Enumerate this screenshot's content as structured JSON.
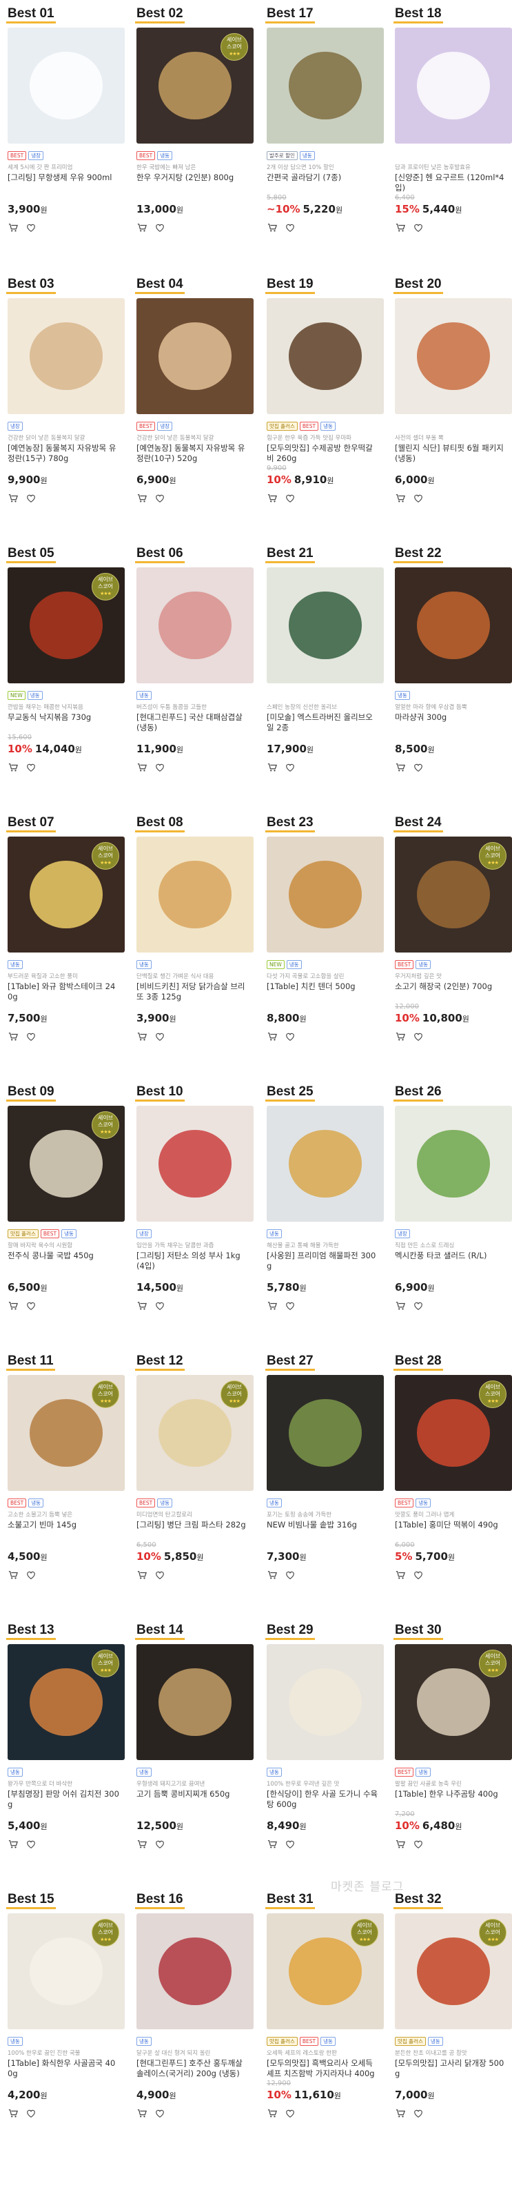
{
  "watermark": "마켓존 블로그",
  "seal_text": {
    "line1": "세이브",
    "line2": "스코어",
    "stars": "★★★"
  },
  "products": [
    {
      "rank": "Best 01",
      "badges": [
        {
          "t": "BEST",
          "k": "best"
        },
        {
          "t": "냉장",
          "k": "cold"
        }
      ],
      "desc": "세계 5시에 갓 짠 프리미엄",
      "name": "[그리팅] 무항생제 우유 900ml",
      "orig": "",
      "rate": "",
      "price": "3,900",
      "color": "#e9eef3",
      "accent": "#ffffff",
      "seal": false
    },
    {
      "rank": "Best 02",
      "badges": [
        {
          "t": "BEST",
          "k": "best"
        },
        {
          "t": "냉동",
          "k": "cold"
        }
      ],
      "desc": "한우 국밥에는 빠져 남은",
      "name": "한우 우거지탕 (2인분) 800g",
      "orig": "",
      "rate": "",
      "price": "13,000",
      "color": "#3a2f2a",
      "accent": "#c7a061",
      "seal": true
    },
    {
      "rank": "Best 17",
      "badges": [
        {
          "t": "발주로 할인",
          "k": "pay"
        },
        {
          "t": "냉동",
          "k": "cold"
        }
      ],
      "desc": "2개 이상 담으면 10% 할인",
      "name": "간편국 골라담기 (7종)",
      "orig": "5,800",
      "rate": "~10%",
      "price": "5,220",
      "color": "#c8cfbf",
      "accent": "#7e6a3c",
      "seal": false
    },
    {
      "rank": "Best 18",
      "badges": [],
      "desc": "담과 프로이틴 낮은 농후발효유",
      "name": "[신양준] 헨 요구르트 (120ml*4입)",
      "orig": "6,400",
      "rate": "15%",
      "price": "5,440",
      "color": "#d6c9e8",
      "accent": "#ffffff",
      "seal": false
    },
    {
      "rank": "Best 03",
      "badges": [
        {
          "t": "냉장",
          "k": "cold"
        }
      ],
      "desc": "건강한 닭이 낳은 동물복지 달걀",
      "name": "[예연농장] 동물복지 자유방목 유정란(15구) 780g",
      "orig": "",
      "rate": "",
      "price": "9,900",
      "color": "#f2e8d8",
      "accent": "#d7b48a",
      "seal": false
    },
    {
      "rank": "Best 04",
      "badges": [
        {
          "t": "BEST",
          "k": "best"
        },
        {
          "t": "냉장",
          "k": "cold"
        }
      ],
      "desc": "건강한 닭이 낳은 동물복지 달걀",
      "name": "[예연농장] 동물복지 자유방목 유정란(10구) 520g",
      "orig": "",
      "rate": "",
      "price": "6,900",
      "color": "#6b4a32",
      "accent": "#e6c59a",
      "seal": false
    },
    {
      "rank": "Best 19",
      "badges": [
        {
          "t": "맛집 플러스",
          "k": "pick"
        },
        {
          "t": "BEST",
          "k": "best"
        },
        {
          "t": "냉동",
          "k": "cold"
        }
      ],
      "desc": "힘구운 한우 육즙 가득 맛집 우마파",
      "name": "[모두의맛집] 수제공방 한우떡갈비 260g",
      "orig": "9,900",
      "rate": "10%",
      "price": "8,910",
      "color": "#e9e5dc",
      "accent": "#5a3a22",
      "seal": false
    },
    {
      "rank": "Best 20",
      "badges": [],
      "desc": "사전의 셀더 부울 뽁",
      "name": "[웰린지 식단] 뷰티핏 6월 패키지 (냉동)",
      "orig": "",
      "rate": "",
      "price": "6,000",
      "color": "#eee9e2",
      "accent": "#c86a3c",
      "seal": false
    },
    {
      "rank": "Best 05",
      "badges": [
        {
          "t": "NEW",
          "k": "new"
        },
        {
          "t": "냉동",
          "k": "cold"
        }
      ],
      "desc": "깐밥을 채우는 매콤한 낙지볶음",
      "name": "무교동식 낙지볶음 730g",
      "orig": "15,600",
      "rate": "10%",
      "price": "14,040",
      "color": "#2a211c",
      "accent": "#b5361f",
      "seal": true
    },
    {
      "rank": "Best 06",
      "badges": [
        {
          "t": "냉동",
          "k": "cold"
        }
      ],
      "desc": "버즈섬이 두툼 돔콤을 고들한",
      "name": "[현대그린푸드] 국산 대패삼겹살 (냉동)",
      "orig": "",
      "rate": "",
      "price": "11,900",
      "color": "#e9dcdb",
      "accent": "#d98d8a",
      "seal": false
    },
    {
      "rank": "Best 21",
      "badges": [],
      "desc": "스페인 농장의 신선한 올리브",
      "name": "[미모솔] 엑스트라버진 올리브오일 2종",
      "orig": "",
      "rate": "",
      "price": "17,900",
      "color": "#e3e6dd",
      "accent": "#2e5a3a",
      "seal": false
    },
    {
      "rank": "Best 22",
      "badges": [
        {
          "t": "냉동",
          "k": "cold"
        }
      ],
      "desc": "얼얼한 마라 향에 우삼겹 듬뿍",
      "name": "마라샹궈 300g",
      "orig": "",
      "rate": "",
      "price": "8,500",
      "color": "#3a2a22",
      "accent": "#c7672e",
      "seal": false
    },
    {
      "rank": "Best 07",
      "badges": [
        {
          "t": "냉동",
          "k": "cold"
        }
      ],
      "desc": "부드러운 육질과 고소한 풍미",
      "name": "[1Table] 와규 함박스테이크 240g",
      "orig": "",
      "rate": "",
      "price": "7,500",
      "color": "#3b2a22",
      "accent": "#f4d36a",
      "seal": true
    },
    {
      "rank": "Best 08",
      "badges": [
        {
          "t": "냉동",
          "k": "cold"
        }
      ],
      "desc": "단백질로 챙긴 가벼운 식사 대용",
      "name": "[비비드키친] 저당 닭가슴살 브리또 3종 125g",
      "orig": "",
      "rate": "",
      "price": "3,900",
      "color": "#f1e4c6",
      "accent": "#d8a35a",
      "seal": false
    },
    {
      "rank": "Best 23",
      "badges": [
        {
          "t": "NEW",
          "k": "new"
        },
        {
          "t": "냉동",
          "k": "cold"
        }
      ],
      "desc": "다섯 가지 곡물로 고소함을 살린",
      "name": "[1Table] 치킨 텐더 500g",
      "orig": "",
      "rate": "",
      "price": "8,800",
      "color": "#e3d7c7",
      "accent": "#c88a3a",
      "seal": false
    },
    {
      "rank": "Best 24",
      "badges": [
        {
          "t": "BEST",
          "k": "best"
        },
        {
          "t": "냉동",
          "k": "cold"
        }
      ],
      "desc": "우거지처럼 깊은 맛",
      "name": "소고기 해장국 (2인분) 700g",
      "orig": "12,000",
      "rate": "10%",
      "price": "10,800",
      "color": "#3a2e26",
      "accent": "#9c6a36",
      "seal": true
    },
    {
      "rank": "Best 09",
      "badges": [
        {
          "t": "맛집 플러스",
          "k": "pick"
        },
        {
          "t": "BEST",
          "k": "best"
        },
        {
          "t": "냉동",
          "k": "cold"
        }
      ],
      "desc": "할매 바지락 육수의 시원함",
      "name": "전주식 콩나물 국밥 450g",
      "orig": "",
      "rate": "",
      "price": "6,500",
      "color": "#2f2722",
      "accent": "#e9e0c9",
      "seal": true
    },
    {
      "rank": "Best 10",
      "badges": [
        {
          "t": "냉장",
          "k": "cold"
        }
      ],
      "desc": "입안을 가득 채우는 달콤한 과즙",
      "name": "[그리팅] 저탄소 의성 부사 1kg (4입)",
      "orig": "",
      "rate": "",
      "price": "14,500",
      "color": "#ece3de",
      "accent": "#c93a3a",
      "seal": false
    },
    {
      "rank": "Best 25",
      "badges": [
        {
          "t": "냉동",
          "k": "cold"
        }
      ],
      "desc": "해산물 골고 통째 해물 가득한",
      "name": "[사옹원] 프리미엄 해물파전 300g",
      "orig": "",
      "rate": "",
      "price": "5,780",
      "color": "#dfe3e6",
      "accent": "#d9a648",
      "seal": false
    },
    {
      "rank": "Best 26",
      "badges": [
        {
          "t": "냉장",
          "k": "cold"
        }
      ],
      "desc": "직접 만든 소스로 드레싱",
      "name": "멕시칸풍 타코 샐러드 (R/L)",
      "orig": "",
      "rate": "",
      "price": "6,900",
      "color": "#e8ebe2",
      "accent": "#6aa345",
      "seal": false
    },
    {
      "rank": "Best 11",
      "badges": [
        {
          "t": "BEST",
          "k": "best"
        },
        {
          "t": "냉동",
          "k": "cold"
        }
      ],
      "desc": "고소한 소불고기 듬뿍 넣은",
      "name": "소불고기 빈마 145g",
      "orig": "",
      "rate": "",
      "price": "4,500",
      "color": "#e6dccf",
      "accent": "#b27a3c",
      "seal": true
    },
    {
      "rank": "Best 12",
      "badges": [
        {
          "t": "BEST",
          "k": "best"
        },
        {
          "t": "냉동",
          "k": "cold"
        }
      ],
      "desc": "미디엄면의 탄고칼로리",
      "name": "[그리팅] 병단 크림 파스타 282g",
      "orig": "6,500",
      "rate": "10%",
      "price": "5,850",
      "color": "#e9e1d6",
      "accent": "#e4cf9e",
      "seal": true
    },
    {
      "rank": "Best 27",
      "badges": [
        {
          "t": "냉동",
          "k": "cold"
        }
      ],
      "desc": "포기는 토핑 송송에 가득한",
      "name": "NEW 비빔나물 솥밥 316g",
      "orig": "",
      "rate": "",
      "price": "7,300",
      "color": "#2c2a27",
      "accent": "#7e9a4a",
      "seal": false
    },
    {
      "rank": "Best 28",
      "badges": [
        {
          "t": "BEST",
          "k": "best"
        },
        {
          "t": "냉동",
          "k": "cold"
        }
      ],
      "desc": "맛깔도 풍미 그러나 맵게",
      "name": "[1Table] 홍미단 떡볶이 490g",
      "orig": "6,000",
      "rate": "5%",
      "price": "5,700",
      "color": "#2e2523",
      "accent": "#d4492e",
      "seal": true
    },
    {
      "rank": "Best 13",
      "badges": [
        {
          "t": "냉동",
          "k": "cold"
        }
      ],
      "desc": "왕가우 반쪽으로 더 바삭한",
      "name": "[부침명장] 판망 어쉬 김치전 300g",
      "orig": "",
      "rate": "",
      "price": "5,400",
      "color": "#1e2a33",
      "accent": "#d9823e",
      "seal": true
    },
    {
      "rank": "Best 14",
      "badges": [
        {
          "t": "냉동",
          "k": "cold"
        }
      ],
      "desc": "우형생레 돼지고기로 끓여낸",
      "name": "고기 듬뿍 콩비지찌개 650g",
      "orig": "",
      "rate": "",
      "price": "12,500",
      "color": "#2a2420",
      "accent": "#c9a46a",
      "seal": false
    },
    {
      "rank": "Best 29",
      "badges": [
        {
          "t": "냉동",
          "k": "cold"
        }
      ],
      "desc": "100% 한우로 우려낸 깊은 맛",
      "name": "[한식당이] 한우 사골 도가니 수육탕 600g",
      "orig": "",
      "rate": "",
      "price": "8,490",
      "color": "#e7e3dd",
      "accent": "#f0eadc",
      "seal": false
    },
    {
      "rank": "Best 30",
      "badges": [
        {
          "t": "BEST",
          "k": "best"
        },
        {
          "t": "냉동",
          "k": "cold"
        }
      ],
      "desc": "팔팔 끓인 사골로 농축 우린",
      "name": "[1Table] 한우 나주곰탕 400g",
      "orig": "7,200",
      "rate": "10%",
      "price": "6,480",
      "color": "#3a302a",
      "accent": "#e0d3bc",
      "seal": true
    },
    {
      "rank": "Best 15",
      "badges": [
        {
          "t": "냉동",
          "k": "cold"
        }
      ],
      "desc": "100% 한우로 끓인 진한 국물",
      "name": "[1Table] 화식한우 사골곰국 400g",
      "orig": "",
      "rate": "",
      "price": "4,200",
      "color": "#ece7df",
      "accent": "#f5f1e9",
      "seal": true
    },
    {
      "rank": "Best 16",
      "badges": [
        {
          "t": "냉동",
          "k": "cold"
        }
      ],
      "desc": "달구운 살 대신 형겨 되지 올린",
      "name": "[현대그린푸드] 호주산 홍두깨살 솔레이스(국거리) 200g (냉동)",
      "orig": "",
      "rate": "",
      "price": "4,900",
      "color": "#e2d8d6",
      "accent": "#b0323a",
      "seal": false
    },
    {
      "rank": "Best 31",
      "badges": [
        {
          "t": "맛집 플러스",
          "k": "pick"
        },
        {
          "t": "BEST",
          "k": "best"
        },
        {
          "t": "냉동",
          "k": "cold"
        }
      ],
      "desc": "오세득 셰프의 레스토랑 한판",
      "name": "[모두의맛집] 흑백요리사 오세득 셰프 치즈함박 가지라자냐 400g",
      "orig": "12,900",
      "rate": "10%",
      "price": "11,610",
      "color": "#e5ddd0",
      "accent": "#e0a33a",
      "seal": true
    },
    {
      "rank": "Best 32",
      "badges": [
        {
          "t": "맛집 플러스",
          "k": "pick"
        },
        {
          "t": "냉동",
          "k": "cold"
        }
      ],
      "desc": "분든한 찬초 이내고를 공 참맛",
      "name": "[모두의맛집] 고사리 닭개장 500g",
      "orig": "",
      "rate": "",
      "price": "7,000",
      "color": "#ece4dc",
      "accent": "#c2401f",
      "seal": true
    }
  ],
  "labels": {
    "won": "원",
    "cart": "cart-icon",
    "like": "heart-icon"
  }
}
